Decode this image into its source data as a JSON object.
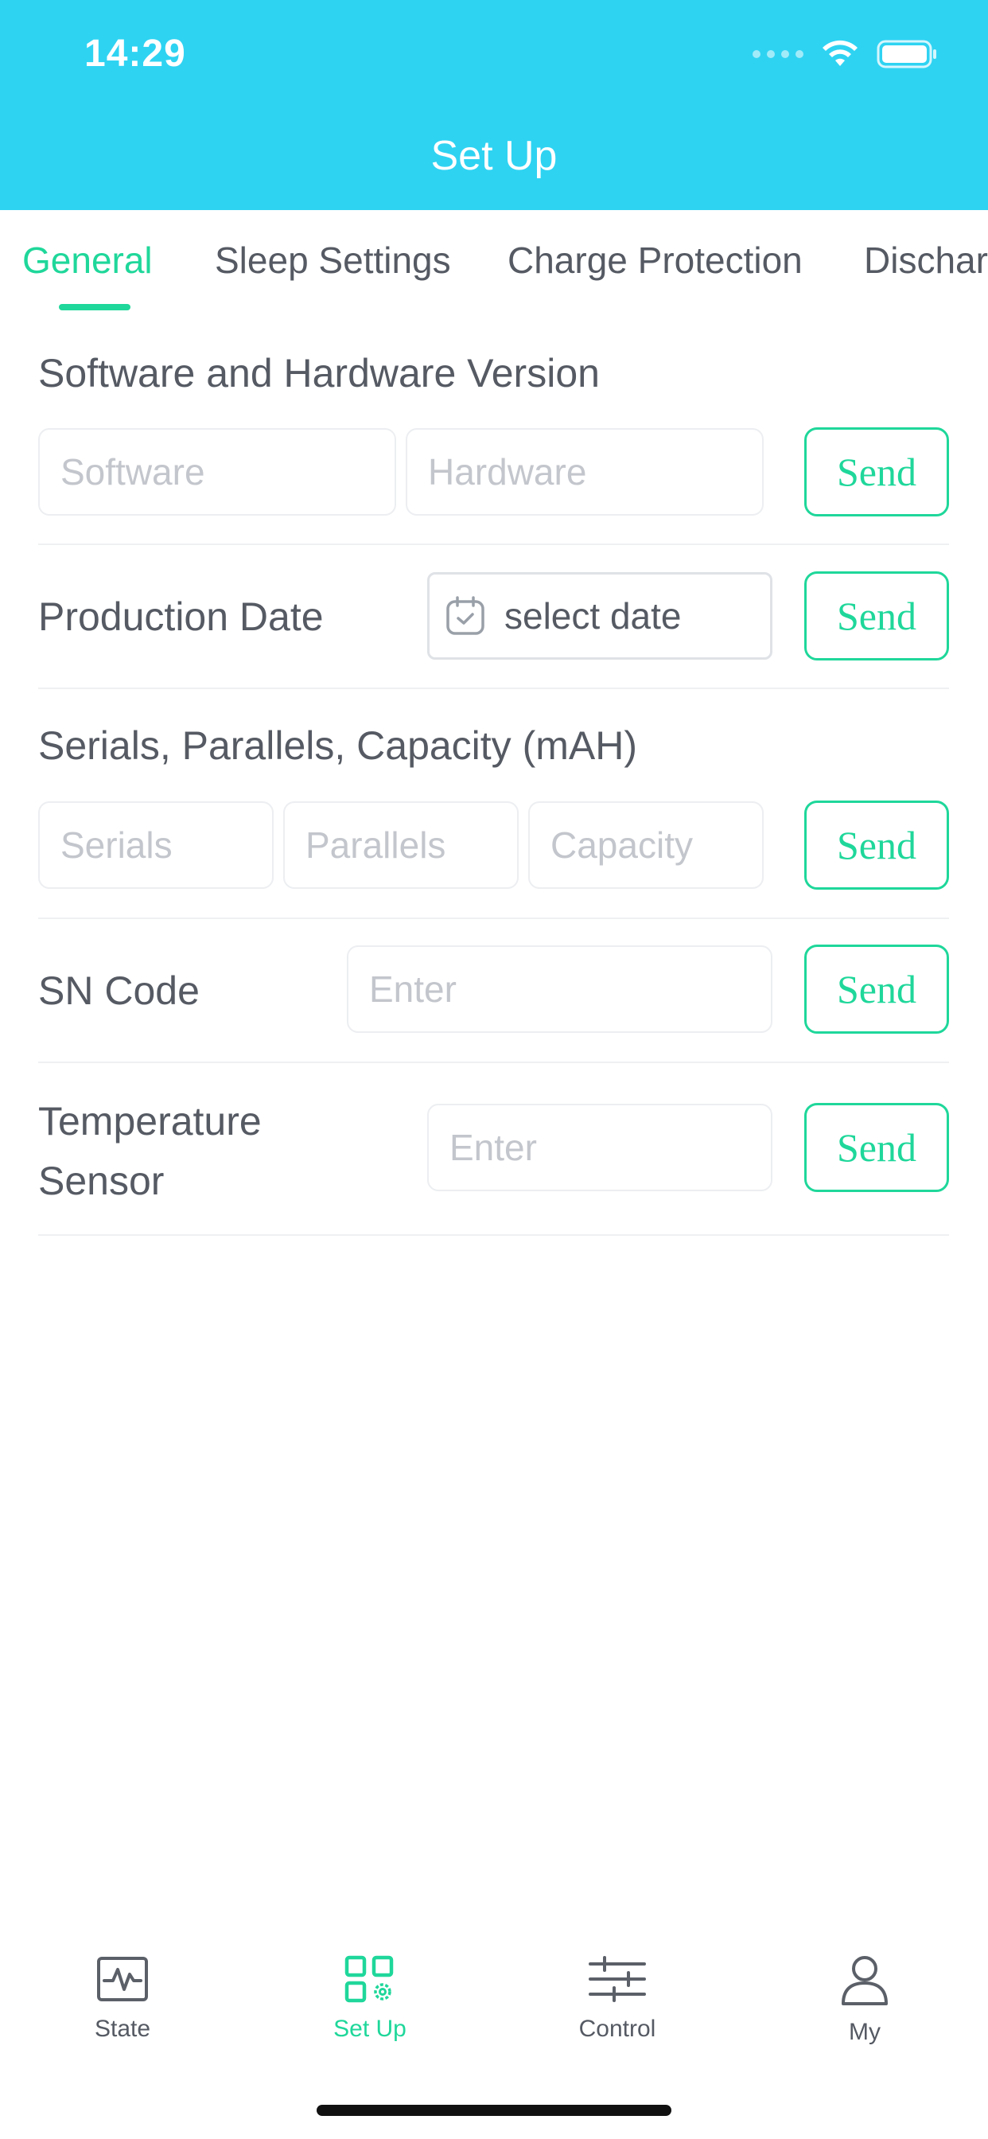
{
  "status_bar": {
    "time": "14:29"
  },
  "header": {
    "title": "Set Up"
  },
  "tabs": [
    {
      "label": "General",
      "active": true
    },
    {
      "label": "Sleep Settings",
      "active": false
    },
    {
      "label": "Charge Protection",
      "active": false
    },
    {
      "label": "Dischar",
      "active": false
    }
  ],
  "version_section": {
    "title": "Software and Hardware Version",
    "software_placeholder": "Software",
    "hardware_placeholder": "Hardware",
    "send_label": "Send"
  },
  "production_date": {
    "label": "Production Date",
    "date_value": "select date",
    "send_label": "Send"
  },
  "config_section": {
    "title": "Serials, Parallels, Capacity (mAH)",
    "serials_placeholder": "Serials",
    "parallels_placeholder": "Parallels",
    "capacity_placeholder": "Capacity",
    "send_label": "Send"
  },
  "sn_code": {
    "label": "SN Code",
    "placeholder": "Enter",
    "send_label": "Send"
  },
  "temperature_sensor": {
    "label_line1": "Temperature",
    "label_line2": "Sensor",
    "placeholder": "Enter",
    "send_label": "Send"
  },
  "tabbar": [
    {
      "label": "State",
      "icon": "pulse-icon",
      "active": false
    },
    {
      "label": "Set Up",
      "icon": "grid-settings-icon",
      "active": true
    },
    {
      "label": "Control",
      "icon": "sliders-icon",
      "active": false
    },
    {
      "label": "My",
      "icon": "user-icon",
      "active": false
    }
  ],
  "colors": {
    "header": "#2fd3f2",
    "accent": "#1fd79a",
    "text": "#555a63",
    "placeholder": "#c3c6cc"
  }
}
